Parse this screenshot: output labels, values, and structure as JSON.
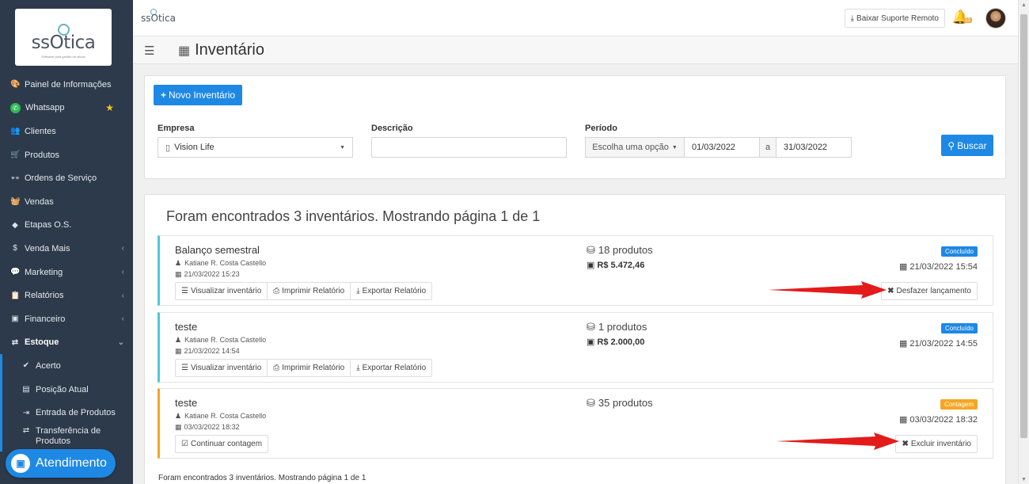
{
  "sidebar": {
    "logo_text": "ssOtica",
    "logo_subtitle": "Software para gestão de óticas",
    "items": [
      {
        "label": "Painel de Informações",
        "icon": "dashboard-icon",
        "glyph": "🎨"
      },
      {
        "label": "Whatsapp",
        "icon": "whatsapp-icon",
        "glyph": "✆"
      },
      {
        "label": "Clientes",
        "icon": "users-icon",
        "glyph": "👥"
      },
      {
        "label": "Produtos",
        "icon": "cart-icon",
        "glyph": "🛒"
      },
      {
        "label": "Ordens de Serviço",
        "icon": "glasses-icon",
        "glyph": "👓"
      },
      {
        "label": "Vendas",
        "icon": "basket-icon",
        "glyph": "🧺"
      },
      {
        "label": "Etapas O.S.",
        "icon": "tag-icon",
        "glyph": "◆"
      },
      {
        "label": "Venda Mais",
        "icon": "dollar-icon",
        "glyph": "$"
      },
      {
        "label": "Marketing",
        "icon": "comments-icon",
        "glyph": "💬"
      },
      {
        "label": "Relatórios",
        "icon": "report-icon",
        "glyph": "📋"
      },
      {
        "label": "Financeiro",
        "icon": "money-icon",
        "glyph": "▣"
      },
      {
        "label": "Estoque",
        "icon": "exchange-icon",
        "glyph": "⇄"
      }
    ],
    "sub_items": [
      {
        "label": "Acerto",
        "icon": "check-icon",
        "glyph": "✔"
      },
      {
        "label": "Posição Atual",
        "icon": "file-icon",
        "glyph": "▤"
      },
      {
        "label": "Entrada de Produtos",
        "icon": "sign-in-icon",
        "glyph": "⇥"
      },
      {
        "label": "Transferência de Produtos",
        "icon": "transfer-icon",
        "glyph": "⇄"
      }
    ],
    "atendimento": "Atendimento"
  },
  "topbar": {
    "logo_text": "ssOtica",
    "suporte_label": "Baixar Suporte Remoto",
    "notification_count": "11"
  },
  "page": {
    "title": "Inventário"
  },
  "filters": {
    "new_button": "Novo Inventário",
    "empresa_label": "Empresa",
    "empresa_value": "Vision Life",
    "descricao_label": "Descrição",
    "descricao_value": "",
    "periodo_label": "Período",
    "periodo_select": "Escolha uma opção",
    "date_from": "01/03/2022",
    "date_sep": "a",
    "date_to": "31/03/2022",
    "search_button": "Buscar"
  },
  "results": {
    "heading": "Foram encontrados 3 inventários. Mostrando página 1 de 1",
    "footer": "Foram encontrados 3 inventários. Mostrando página 1 de 1",
    "cards": [
      {
        "title": "Balanço semestral",
        "user": "Katiane R. Costa Castello",
        "date": "21/03/2022 15:23",
        "products": "18 produtos",
        "value": "R$ 5.472,46",
        "status": "Concluído",
        "status_color": "#1e88e5",
        "final_date": "21/03/2022 15:54",
        "actions": [
          "Visualizar inventário",
          "Imprimir Relatório",
          "Exportar Relatório"
        ],
        "right_action": "Desfazer lançamento"
      },
      {
        "title": "teste",
        "user": "Katiane R. Costa Castello",
        "date": "21/03/2022 14:54",
        "products": "1 produtos",
        "value": "R$ 2.000,00",
        "status": "Concluído",
        "status_color": "#1e88e5",
        "final_date": "21/03/2022 14:55",
        "actions": [
          "Visualizar inventário",
          "Imprimir Relatório",
          "Exportar Relatório"
        ],
        "right_action": ""
      },
      {
        "title": "teste",
        "user": "Katiane R. Costa Castello",
        "date": "03/03/2022 18:32",
        "products": "35 produtos",
        "value": "",
        "status": "Contagem",
        "status_color": "#f5a623",
        "final_date": "03/03/2022 18:32",
        "actions": [
          "Continuar contagem"
        ],
        "right_action": "Excluir inventário"
      }
    ]
  },
  "colors": {
    "accent": "#1e88e5",
    "sidebar_bg": "#2c3a4b",
    "arrow_red": "#e31b1b"
  }
}
